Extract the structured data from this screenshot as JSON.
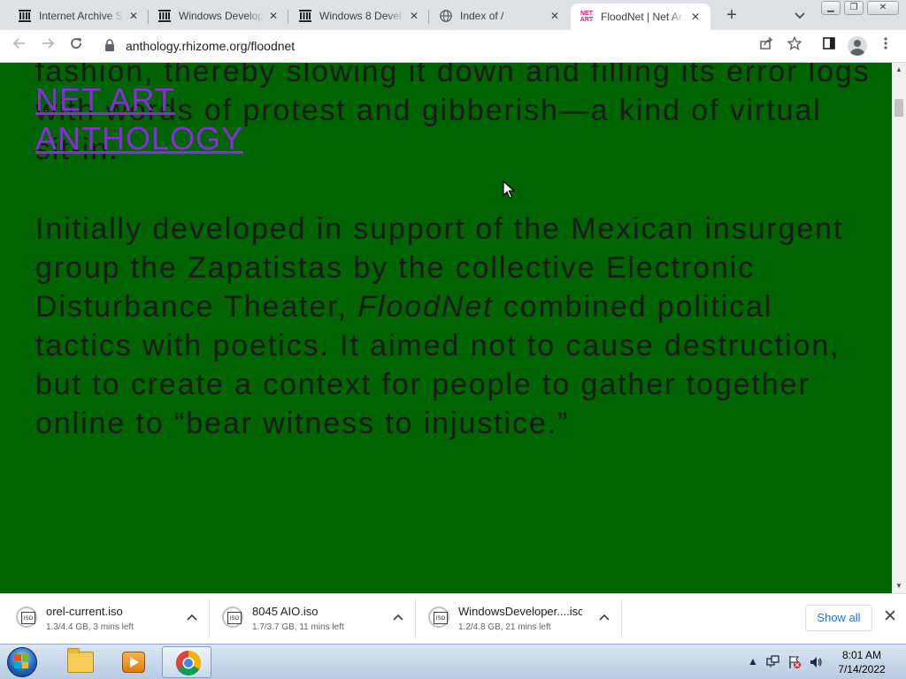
{
  "browser": {
    "tabs": [
      {
        "title": "Internet Archive S",
        "favicon": "archive-icon",
        "active": false
      },
      {
        "title": "Windows Develop",
        "favicon": "archive-icon",
        "active": false
      },
      {
        "title": "Windows 8 Devel",
        "favicon": "archive-icon",
        "active": false
      },
      {
        "title": "Index of /",
        "favicon": "globe-icon",
        "active": false
      },
      {
        "title": "FloodNet | Net Ar",
        "favicon": "net-art-icon",
        "favicon_text": "NET ART",
        "active": true
      }
    ],
    "new_tab_label": "+",
    "url": "anthology.rhizome.org/floodnet"
  },
  "page": {
    "logo_line1": "NET ART",
    "logo_line2": "ANTHOLOGY",
    "paragraph1": {
      "line1": "fashion, thereby slowing it down and filling its error logs",
      "line2": "with words of protest and gibberish—a kind of virtual",
      "line3": "sit-in."
    },
    "paragraph2": {
      "line1": "Initially developed in support of the Mexican insurgent",
      "line2": "group the Zapatistas by the collective Electronic",
      "line3_a": "Disturbance Theater, ",
      "line3_em": "FloodNet",
      "line3_b": " combined political",
      "line4": "tactics with poetics. It aimed not to cause destruction,",
      "line5": "but to create a context for people to gather together",
      "line6": "online to “bear witness to injustice.”"
    },
    "background_color": "#006400",
    "link_color": "#8a2be2"
  },
  "downloads": {
    "items": [
      {
        "name": "orel-current.iso",
        "status": "1.3/4.4 GB, 3 mins left",
        "icon_label": "ISO"
      },
      {
        "name": "8045 AIO.iso",
        "status": "1.7/3.7 GB, 11 mins left",
        "icon_label": "ISO"
      },
      {
        "name": "WindowsDeveloper....iso",
        "status": "1.2/4.8 GB, 21 mins left",
        "icon_label": "ISO"
      }
    ],
    "show_all_label": "Show all"
  },
  "taskbar": {
    "time": "8:01 AM",
    "date": "7/14/2022"
  }
}
